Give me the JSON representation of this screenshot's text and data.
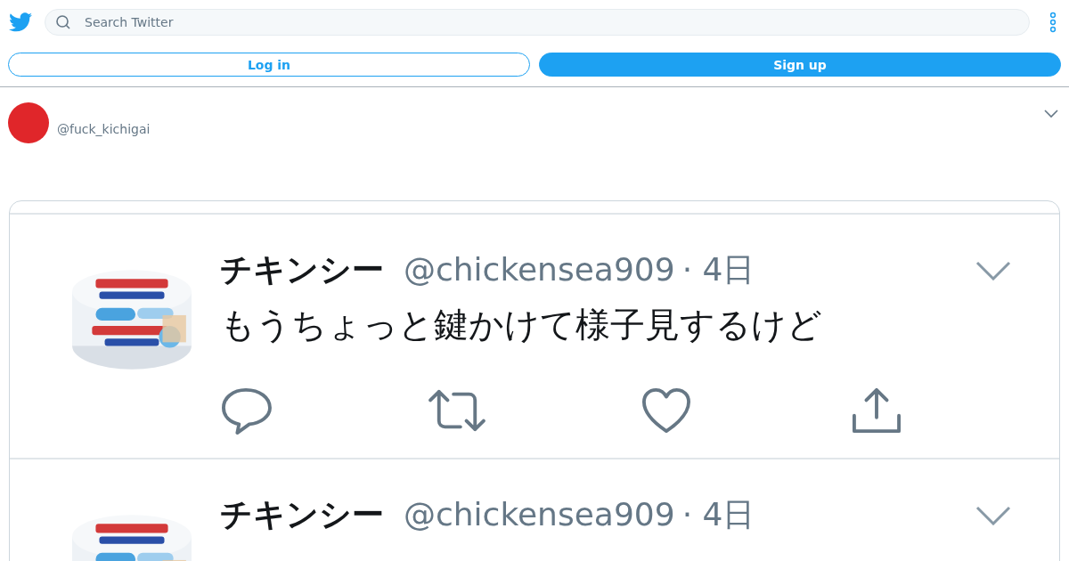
{
  "header": {
    "search": {
      "placeholder": "Search Twitter"
    }
  },
  "buttons": [
    {
      "label": "Log in",
      "kind": "outline"
    },
    {
      "label": "Sign up",
      "kind": "filled"
    }
  ],
  "tweet": {
    "handle": "@fuck_kichigai"
  },
  "embedded_screenshot": {
    "tweets": [
      {
        "name": "チキンシー",
        "handle": "@chickensea909",
        "time": "· 4日",
        "text": "もうちょっと鍵かけて様子見するけど"
      },
      {
        "name": "チキンシー",
        "handle": "@chickensea909",
        "time": "· 4日"
      }
    ]
  }
}
